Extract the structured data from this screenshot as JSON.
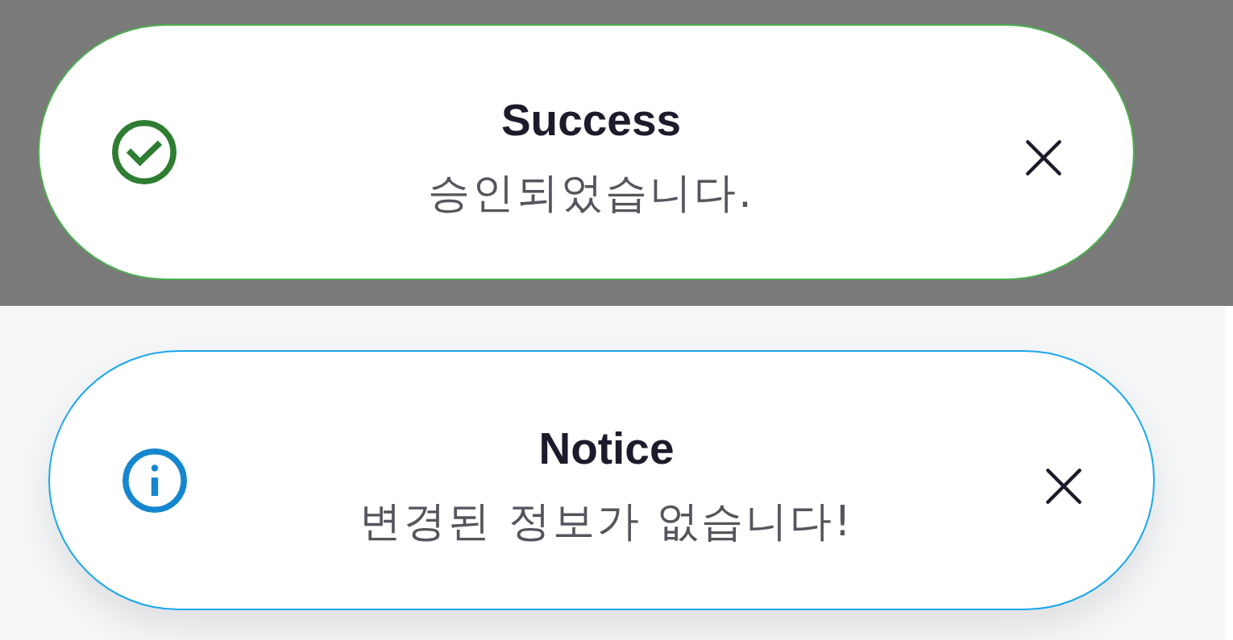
{
  "toasts": [
    {
      "kind": "success",
      "dimmed": true,
      "title": "Success",
      "message": "승인되었습니다."
    },
    {
      "kind": "info",
      "dimmed": false,
      "title": "Notice",
      "message": "변경된 정보가 없습니다!"
    }
  ]
}
